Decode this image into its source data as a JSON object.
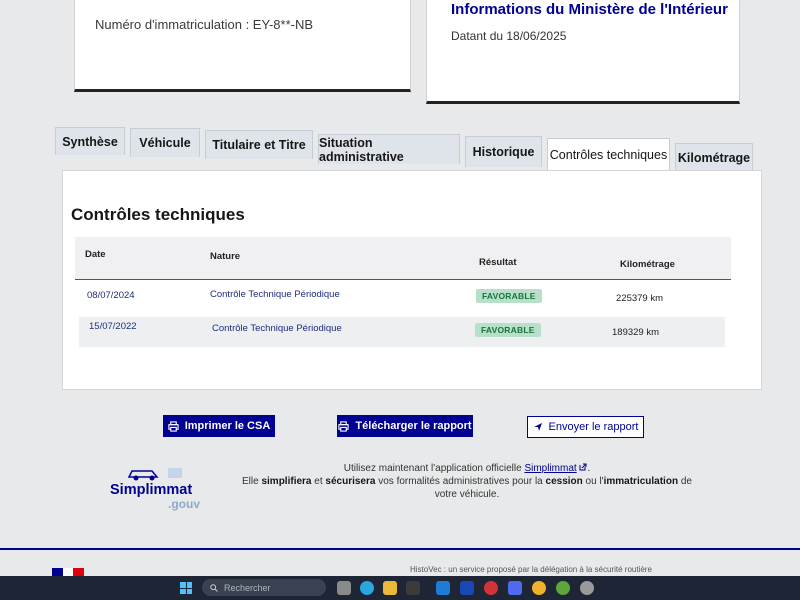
{
  "vehicle_card": {
    "registration": "Numéro d'immatriculation : EY-8**-NB"
  },
  "ministry_card": {
    "title": "Informations du Ministère de l'Intérieur",
    "date": "Datant du 18/06/2025"
  },
  "tabs": [
    {
      "label": "Synthèse"
    },
    {
      "label": "Véhicule"
    },
    {
      "label": "Titulaire et Titre"
    },
    {
      "label": "Situation administrative"
    },
    {
      "label": "Historique"
    },
    {
      "label": "Contrôles techniques",
      "active": true
    },
    {
      "label": "Kilométrage"
    }
  ],
  "panel": {
    "title": "Contrôles techniques",
    "columns": {
      "date": "Date",
      "nature": "Nature",
      "result": "Résultat",
      "mileage": "Kilométrage"
    },
    "rows": [
      {
        "date": "08/07/2024",
        "nature": "Contrôle Technique Périodique",
        "result": "FAVORABLE",
        "mileage": "225379 km"
      },
      {
        "date": "15/07/2022",
        "nature": "Contrôle Technique Périodique",
        "result": "FAVORABLE",
        "mileage": "189329 km"
      }
    ]
  },
  "actions": {
    "print": "Imprimer le CSA",
    "download": "Télécharger le rapport",
    "send": "Envoyer le rapport"
  },
  "promo": {
    "logo_word": "Simplimmat",
    "logo_suffix": ".gouv",
    "line1_prefix": "Utilisez maintenant l'application officielle ",
    "line1_link": "Simplimmat",
    "line2_a": "Elle ",
    "line2_b": "simplifiera",
    "line2_c": " et ",
    "line2_d": "sécurisera",
    "line2_e": " vos formalités administratives pour la ",
    "line2_f": "cession",
    "line2_g": " ou l'",
    "line2_h": "immatriculation",
    "line2_i": " de",
    "line3": "votre véhicule."
  },
  "footer": {
    "text": "HistoVec : un service proposé par la délégation à la sécurité routière"
  },
  "taskbar": {
    "search_placeholder": "Rechercher"
  },
  "colors": {
    "brand_blue": "#000091",
    "success_bg": "#b8dfc9",
    "success_text": "#18753c"
  }
}
